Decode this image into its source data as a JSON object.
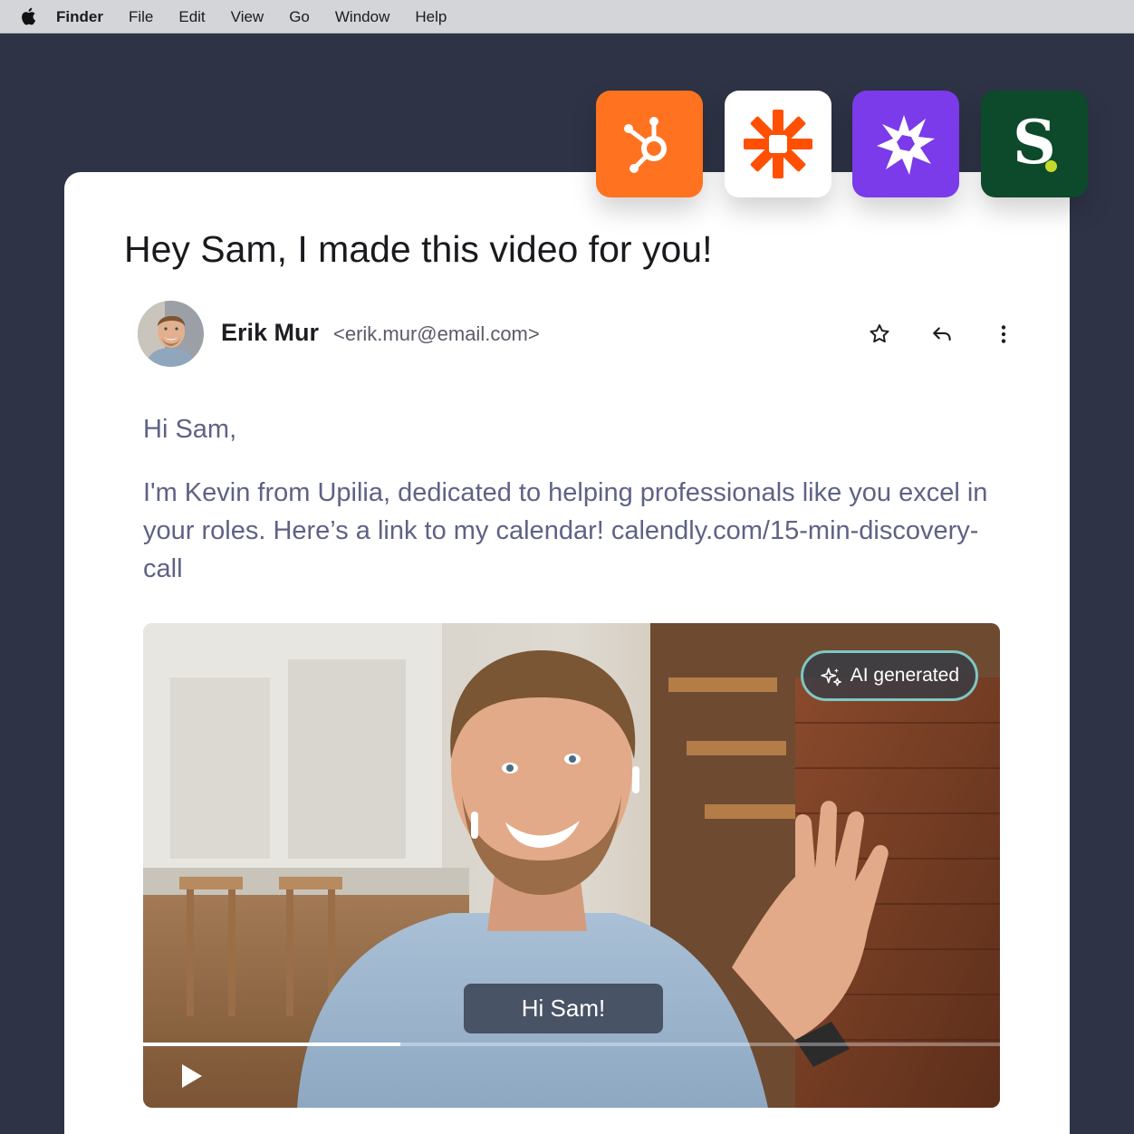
{
  "menubar": {
    "apple_icon": "apple-logo-icon",
    "items": [
      "Finder",
      "File",
      "Edit",
      "View",
      "Go",
      "Window",
      "Help"
    ]
  },
  "integrations": [
    {
      "name": "hubspot-icon",
      "bg": "#ff7220"
    },
    {
      "name": "zapier-icon",
      "bg": "#ffffff",
      "accent": "#ff4f00"
    },
    {
      "name": "burst-app-icon",
      "bg": "#7b3bea"
    },
    {
      "name": "s-brand-icon",
      "bg": "#0d4a2b",
      "letter": "S",
      "dot_color": "#c4d92b"
    }
  ],
  "email": {
    "subject": "Hey Sam, I made this video for you!",
    "sender": {
      "name": "Erik Mur",
      "email": "<erik.mur@email.com>"
    },
    "actions": [
      "star-icon",
      "reply-icon",
      "more-vertical-icon"
    ],
    "greeting": "Hi Sam,",
    "body": "I'm Kevin from Upilia, dedicated to helping professionals like you excel in your roles. Here’s a link to my calendar! calendly.com/15-min-discovery-call"
  },
  "video": {
    "badge": "AI generated",
    "caption": "Hi Sam!",
    "progress": 0.3,
    "play_icon": "play-icon"
  }
}
